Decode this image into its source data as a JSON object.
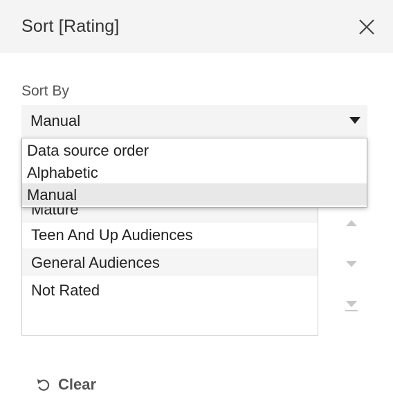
{
  "dialog": {
    "title": "Sort [Rating]"
  },
  "sort_by": {
    "label": "Sort By",
    "selected": "Manual",
    "options": [
      "Data source order",
      "Alphabetic",
      "Manual"
    ],
    "highlighted_option": "Manual"
  },
  "manual_list": {
    "items": [
      "Mature",
      "Teen And Up Audiences",
      "General Audiences",
      "Not Rated"
    ]
  },
  "arrows": {
    "move_up_icon": "triangle-up-icon",
    "move_down_icon": "triangle-down-icon",
    "move_bottom_icon": "triangle-down-bar-icon"
  },
  "footer": {
    "clear_label": "Clear",
    "clear_icon": "undo-icon"
  },
  "colors": {
    "titlebar_bg": "#f4f4f4",
    "select_bg": "#f4f4f4",
    "selected_option_bg": "#e8e8e8",
    "disabled_arrow": "#c8c8c8"
  }
}
